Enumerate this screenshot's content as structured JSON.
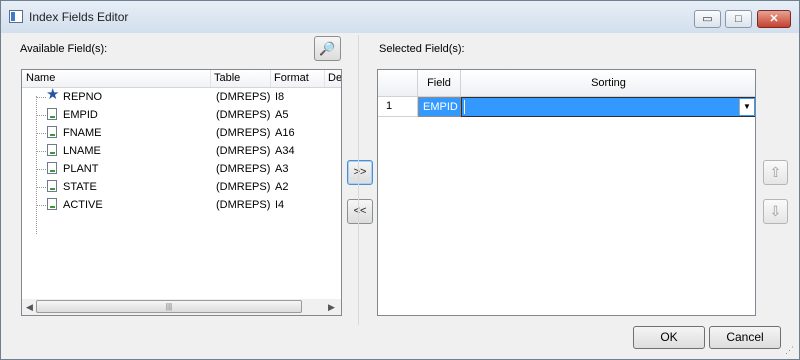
{
  "window": {
    "title": "Index Fields Editor"
  },
  "titlebar": {
    "minimize": "▭",
    "maximize": "□",
    "close": "✕"
  },
  "available": {
    "label": "Available Field(s):",
    "find_icon": "binoculars-icon",
    "columns": [
      "Name",
      "Table",
      "Format",
      "De"
    ],
    "rows": [
      {
        "name": "REPNO",
        "table": "(DMREPS)",
        "format": "I8",
        "icon": "key-star-icon"
      },
      {
        "name": "EMPID",
        "table": "(DMREPS)",
        "format": "A5",
        "icon": "field-icon"
      },
      {
        "name": "FNAME",
        "table": "(DMREPS)",
        "format": "A16",
        "icon": "field-icon"
      },
      {
        "name": "LNAME",
        "table": "(DMREPS)",
        "format": "A34",
        "icon": "field-icon"
      },
      {
        "name": "PLANT",
        "table": "(DMREPS)",
        "format": "A3",
        "icon": "field-icon"
      },
      {
        "name": "STATE",
        "table": "(DMREPS)",
        "format": "A2",
        "icon": "field-icon"
      },
      {
        "name": "ACTIVE",
        "table": "(DMREPS)",
        "format": "I4",
        "icon": "field-icon"
      }
    ],
    "scroll_left": "◀",
    "scroll_right": "▶",
    "scroll_grip": "|||"
  },
  "move": {
    "add": ">>",
    "remove": "<<"
  },
  "selected": {
    "label": "Selected Field(s):",
    "columns": [
      "Field",
      "Sorting"
    ],
    "rows": [
      {
        "num": "1",
        "field": "EMPID",
        "sorting": ""
      }
    ],
    "dropdown_glyph": "▼"
  },
  "order": {
    "up": "⇧",
    "down": "⇩"
  },
  "buttons": {
    "ok": "OK",
    "cancel": "Cancel"
  },
  "colors": {
    "selection": "#3399ff",
    "titlebar": "#dbe5f1",
    "close": "#c4412f"
  }
}
